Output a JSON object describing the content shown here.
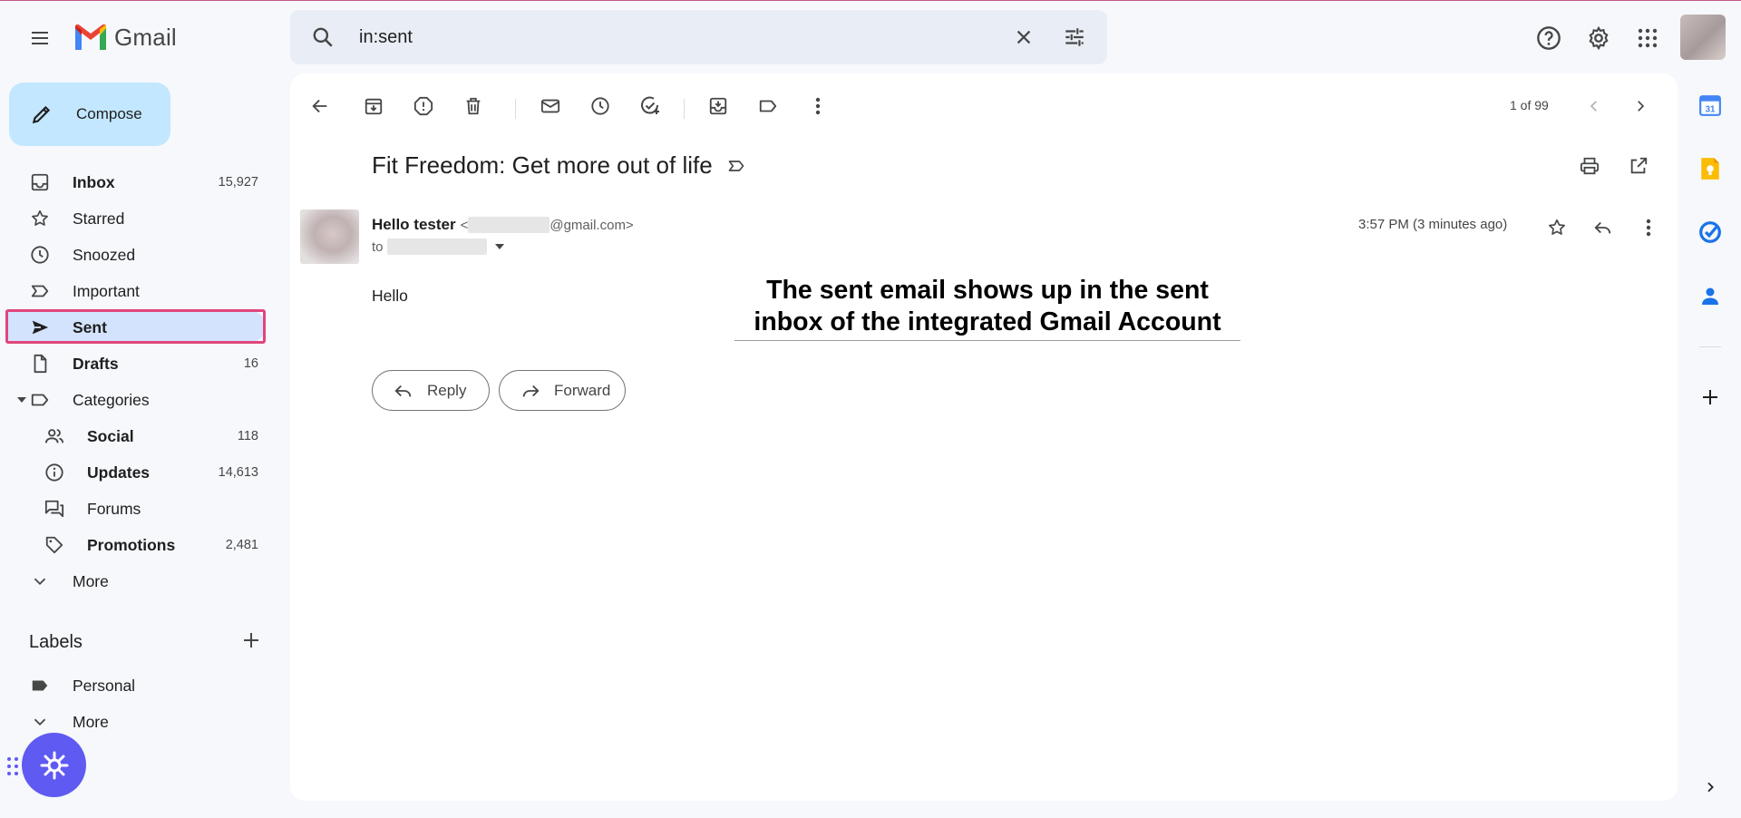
{
  "app": {
    "name": "Gmail",
    "icons": {
      "menu": "hamburger-menu-icon",
      "logo": "gmail-logo-icon",
      "help": "help-icon",
      "settings": "gear-icon",
      "apps": "apps-grid-icon"
    }
  },
  "search": {
    "value": "in:sent"
  },
  "compose": {
    "label": "Compose"
  },
  "sidebar": {
    "items": [
      {
        "label": "Inbox",
        "count": "15,927"
      },
      {
        "label": "Starred",
        "count": ""
      },
      {
        "label": "Snoozed",
        "count": ""
      },
      {
        "label": "Important",
        "count": ""
      },
      {
        "label": "Sent",
        "count": ""
      },
      {
        "label": "Drafts",
        "count": "16"
      },
      {
        "label": "Categories",
        "count": ""
      },
      {
        "label": "Social",
        "count": "118"
      },
      {
        "label": "Updates",
        "count": "14,613"
      },
      {
        "label": "Forums",
        "count": ""
      },
      {
        "label": "Promotions",
        "count": "2,481"
      },
      {
        "label": "More",
        "count": ""
      }
    ],
    "labels_header": "Labels",
    "labels": [
      {
        "label": "Personal"
      },
      {
        "label": "More"
      }
    ]
  },
  "toolbar": {
    "pager": "1 of 99"
  },
  "email": {
    "subject": "Fit Freedom: Get more out of life",
    "sender_name": "Hello tester",
    "sender_lt": "<",
    "sender_domain": "@gmail.com>",
    "to_prefix": "to",
    "time": "3:57 PM (3 minutes ago)",
    "body": "Hello",
    "reply_label": "Reply",
    "forward_label": "Forward"
  },
  "caption": {
    "text": "The sent email shows up in the sent inbox of the integrated Gmail Account"
  },
  "colors": {
    "background": "#f6f8fc",
    "compose": "#c2e7ff",
    "active_nav": "#d3e3fd",
    "highlight_border": "#e0457b",
    "fab": "#5f5af2"
  }
}
